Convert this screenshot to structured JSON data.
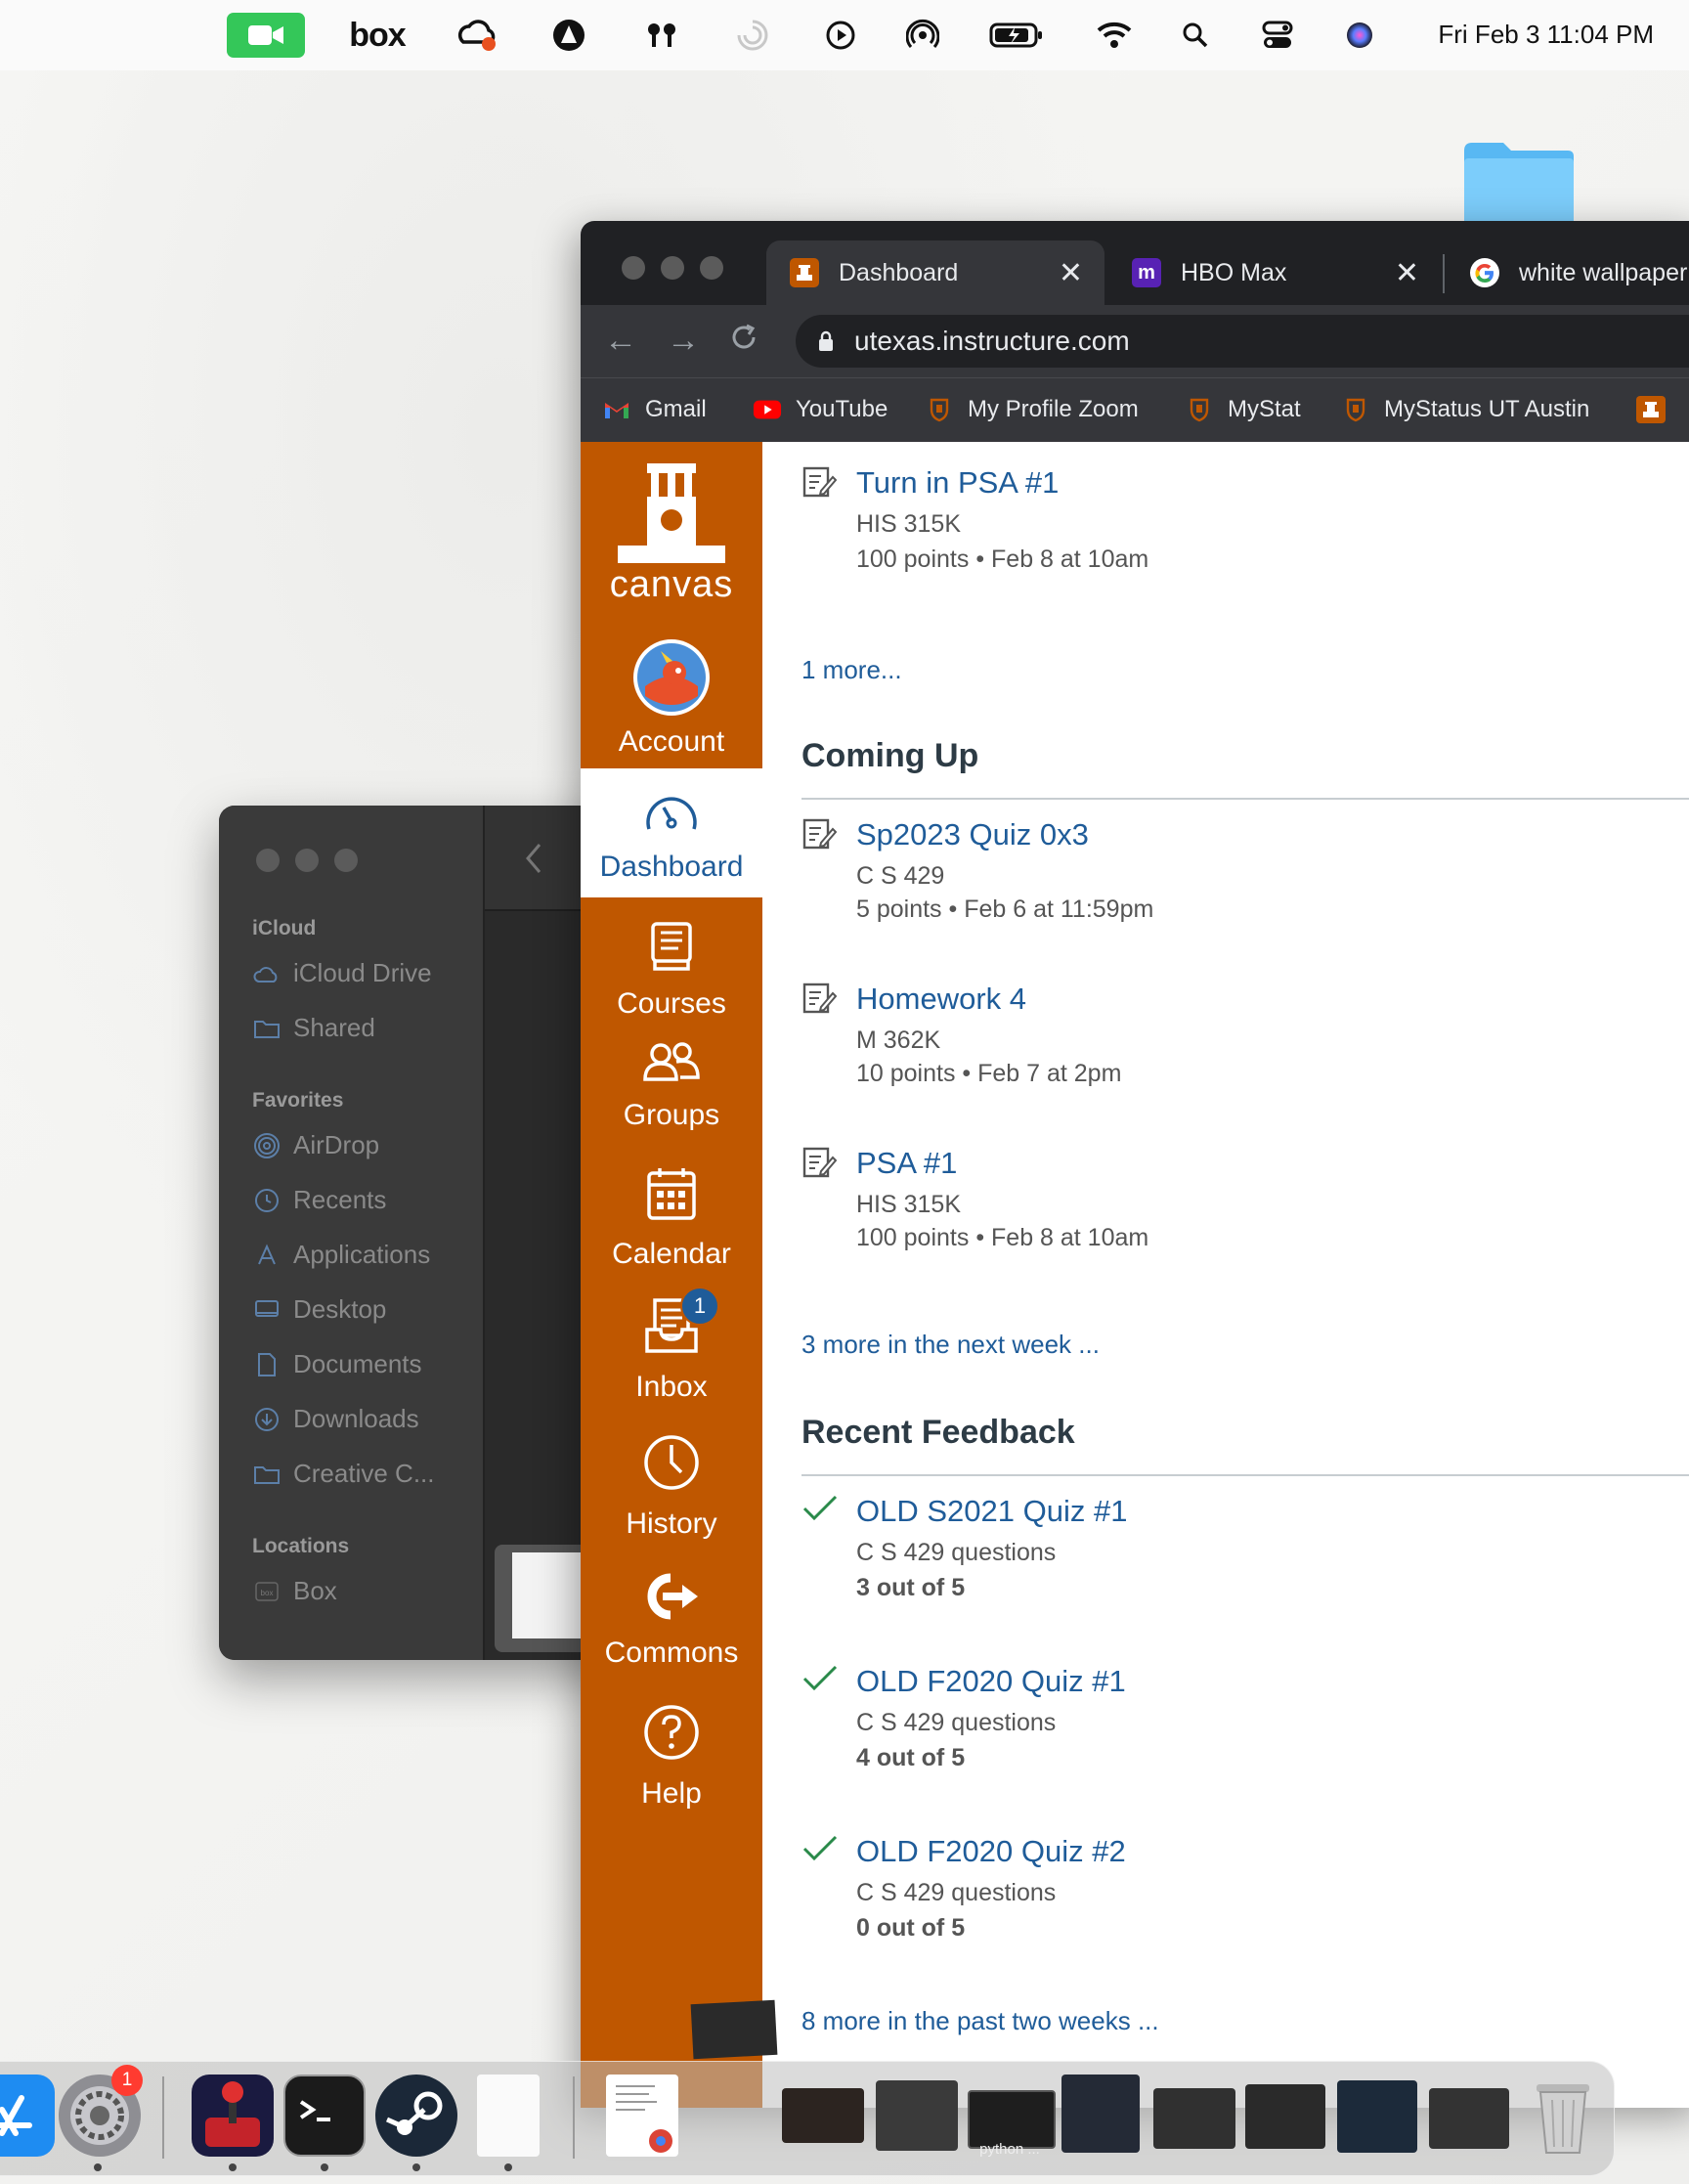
{
  "menubar": {
    "datetime": "Fri Feb 3  11:04 PM",
    "box_label": "box",
    "icons": [
      "facetime-icon",
      "box-icon",
      "creative-cloud-icon",
      "astro-icon",
      "airpods-icon",
      "loading-icon",
      "play-icon",
      "airplay-icon",
      "battery-icon",
      "wifi-icon",
      "spotlight-icon",
      "control-center-icon",
      "siri-icon"
    ]
  },
  "finder": {
    "sections": {
      "icloud": "iCloud",
      "favorites": "Favorites",
      "locations": "Locations"
    },
    "icloud_items": [
      {
        "label": "iCloud Drive",
        "icon": "cloud-icon"
      },
      {
        "label": "Shared",
        "icon": "shared-folder-icon"
      }
    ],
    "favorite_items": [
      {
        "label": "AirDrop",
        "icon": "airdrop-icon"
      },
      {
        "label": "Recents",
        "icon": "clock-icon"
      },
      {
        "label": "Applications",
        "icon": "applications-icon"
      },
      {
        "label": "Desktop",
        "icon": "desktop-icon"
      },
      {
        "label": "Documents",
        "icon": "document-icon"
      },
      {
        "label": "Downloads",
        "icon": "download-icon"
      },
      {
        "label": "Creative C...",
        "icon": "folder-icon"
      }
    ],
    "location_items": [
      {
        "label": "Box",
        "icon": "box-icon"
      }
    ]
  },
  "browser": {
    "tabs": [
      {
        "label": "Dashboard",
        "active": true
      },
      {
        "label": "HBO Max",
        "active": false
      },
      {
        "label": "white wallpaper",
        "active": false
      }
    ],
    "url": "utexas.instructure.com",
    "bookmarks": [
      {
        "label": "Gmail",
        "icon": "gmail-icon"
      },
      {
        "label": "YouTube",
        "icon": "youtube-icon"
      },
      {
        "label": "My Profile Zoom",
        "icon": "ut-shield-icon"
      },
      {
        "label": "MyStat",
        "icon": "ut-shield-icon"
      },
      {
        "label": "MyStatus UT Austin",
        "icon": "ut-shield-icon"
      }
    ]
  },
  "canvas": {
    "logo": "canvas",
    "nav": [
      {
        "label": "Account"
      },
      {
        "label": "Dashboard"
      },
      {
        "label": "Courses"
      },
      {
        "label": "Groups"
      },
      {
        "label": "Calendar"
      },
      {
        "label": "Inbox",
        "badge": "1"
      },
      {
        "label": "History"
      },
      {
        "label": "Commons"
      },
      {
        "label": "Help"
      }
    ],
    "todo_top": {
      "title": "Turn in PSA #1",
      "course": "HIS 315K",
      "meta": "100 points • Feb 8 at 10am"
    },
    "todo_more": "1 more...",
    "coming_up": {
      "heading": "Coming Up",
      "items": [
        {
          "title": "Sp2023 Quiz 0x3",
          "course": "C S 429",
          "meta": "5 points • Feb 6 at 11:59pm"
        },
        {
          "title": "Homework 4",
          "course": "M 362K",
          "meta": "10 points • Feb 7 at 2pm"
        },
        {
          "title": "PSA #1",
          "course": "HIS 315K",
          "meta": "100 points • Feb 8 at 10am"
        }
      ],
      "more": "3 more in the next week ..."
    },
    "recent_feedback": {
      "heading": "Recent Feedback",
      "items": [
        {
          "title": "OLD S2021 Quiz #1",
          "course": "C S 429 questions",
          "score": "3 out of 5"
        },
        {
          "title": "OLD F2020 Quiz #1",
          "course": "C S 429 questions",
          "score": "4 out of 5"
        },
        {
          "title": "OLD F2020 Quiz #2",
          "course": "C S 429 questions",
          "score": "0 out of 5"
        }
      ],
      "more": "8 more in the past two weeks ..."
    }
  },
  "dock": {
    "settings_badge": "1",
    "python_label": "python ..."
  },
  "colors": {
    "canvas_orange": "#bf5700",
    "link_blue": "#1f5c99",
    "check_green": "#2a8a4a"
  }
}
